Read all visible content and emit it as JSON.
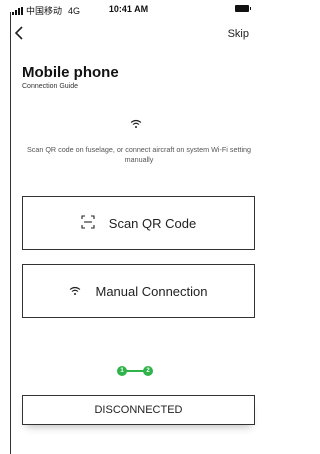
{
  "status_bar": {
    "carrier": "中国移动",
    "network": "4G",
    "time": "10:41 AM"
  },
  "header": {
    "back_icon": "chevron-left-icon",
    "skip_label": "Skip"
  },
  "page": {
    "title": "Mobile phone",
    "subtitle": "Connection Guide",
    "instruction": "Scan QR code on fuselage, or connect aircraft on system Wi-Fi setting manually"
  },
  "options": {
    "scan_label": "Scan QR Code",
    "manual_label": "Manual Connection"
  },
  "progress": {
    "current_step": 2,
    "total_steps": 2,
    "steps": [
      "1",
      "2"
    ],
    "color": "#2fb34a"
  },
  "connection": {
    "status_label": "DISCONNECTED"
  }
}
